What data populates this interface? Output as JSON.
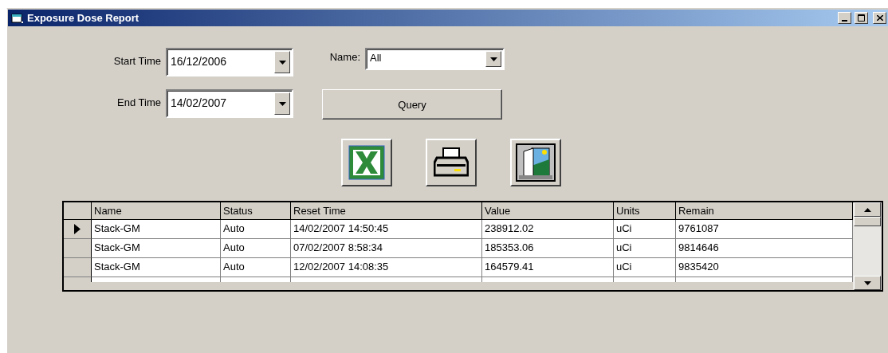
{
  "window": {
    "title": "Exposure Dose Report"
  },
  "filters": {
    "start_time": {
      "label": "Start Time",
      "value": "16/12/2006"
    },
    "end_time": {
      "label": "End Time",
      "value": "14/02/2007"
    },
    "name": {
      "label": "Name:",
      "value": "All"
    },
    "query_button": "Query"
  },
  "toolbar": [
    {
      "kind": "excel"
    },
    {
      "kind": "print"
    },
    {
      "kind": "exit"
    }
  ],
  "table": {
    "columns": [
      "Name",
      "Status",
      "Reset Time",
      "Value",
      "Units",
      "Remain"
    ],
    "rows": [
      {
        "selected": true,
        "cells": [
          "Stack-GM",
          "Auto",
          "14/02/2007 14:50:45",
          "238912.02",
          "uCi",
          "9761087"
        ]
      },
      {
        "selected": false,
        "cells": [
          "Stack-GM",
          "Auto",
          "07/02/2007 8:58:34",
          "185353.06",
          "uCi",
          "9814646"
        ]
      },
      {
        "selected": false,
        "cells": [
          "Stack-GM",
          "Auto",
          "12/02/2007 14:08:35",
          "164579.41",
          "uCi",
          "9835420"
        ]
      }
    ]
  }
}
